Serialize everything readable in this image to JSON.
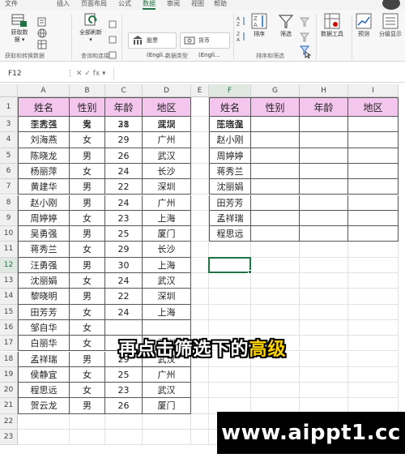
{
  "ribbon": {
    "tabs": [
      "文件",
      "插入",
      "页面布局",
      "公式",
      "数据",
      "审阅",
      "视图",
      "帮助"
    ],
    "active_tab": "数据",
    "get_data": {
      "label1": "获取数",
      "label2": "据 ▾"
    },
    "small_items": [
      "",
      "",
      ""
    ],
    "refresh_all": {
      "label1": "全部刷新",
      "label2": "▾"
    },
    "data_types": [
      {
        "label": "股票 (Engli..."
      },
      {
        "label": "货币 (Engli..."
      }
    ],
    "sort_label": "排序",
    "filter_label": "筛选",
    "data_tools_label": "数据工具",
    "forecast_label": "预测",
    "outline_label": "分级显示",
    "groups": {
      "get_transform": "获取和转换数据",
      "queries": "查询和连接",
      "data_types": "数据类型",
      "sort_filter": "排序和筛选"
    }
  },
  "formula_bar": {
    "name_box": "F12",
    "icons": "⋮  ✕  ✓  fx  ▾",
    "value": ""
  },
  "columns": [
    "A",
    "B",
    "C",
    "D",
    "E",
    "F",
    "G",
    "H",
    "I"
  ],
  "rows": [
    "1",
    "2",
    "3",
    "4",
    "5",
    "6",
    "7",
    "8",
    "9",
    "10",
    "11",
    "12",
    "13",
    "14",
    "15",
    "16",
    "17",
    "18",
    "19",
    "20",
    "21",
    "22",
    "23"
  ],
  "main_table": {
    "headers": [
      "姓名",
      "性别",
      "年龄",
      "地区"
    ],
    "rows": [
      [
        "李秀兰",
        "女",
        "31",
        "武汉"
      ],
      [
        "王志强",
        "男",
        "28",
        "深圳"
      ],
      [
        "刘海燕",
        "女",
        "29",
        "广州"
      ],
      [
        "陈晓龙",
        "男",
        "26",
        "武汉"
      ],
      [
        "杨丽萍",
        "女",
        "24",
        "长沙"
      ],
      [
        "黄建华",
        "男",
        "22",
        "深圳"
      ],
      [
        "赵小刚",
        "男",
        "24",
        "广州"
      ],
      [
        "周婷婷",
        "女",
        "23",
        "上海"
      ],
      [
        "吴勇强",
        "男",
        "25",
        "厦门"
      ],
      [
        "蒋秀兰",
        "女",
        "29",
        "长沙"
      ],
      [
        "汪勇强",
        "男",
        "30",
        "上海"
      ],
      [
        "沈丽娟",
        "女",
        "24",
        "武汉"
      ],
      [
        "黎晓明",
        "男",
        "22",
        "深圳"
      ],
      [
        "田芳芳",
        "女",
        "24",
        "上海"
      ],
      [
        "邹自华",
        "女",
        "",
        ""
      ],
      [
        "白丽华",
        "女",
        "",
        "深圳"
      ],
      [
        "孟祥瑞",
        "男",
        "29",
        "武汉"
      ],
      [
        "侯静宜",
        "女",
        "25",
        "广州"
      ],
      [
        "程思远",
        "女",
        "23",
        "武汉"
      ],
      [
        "贺云龙",
        "男",
        "26",
        "厦门"
      ]
    ]
  },
  "criteria_table": {
    "headers": [
      "姓名",
      "性别",
      "年龄",
      "地区"
    ],
    "names": [
      "王志强",
      "陈晓龙",
      "赵小刚",
      "周婷婷",
      "蒋秀兰",
      "沈丽娟",
      "田芳芳",
      "孟祥瑞",
      "程思远"
    ]
  },
  "subtitle": {
    "normal": "再点击筛选下的",
    "highlight": "高级"
  },
  "watermark": "www.aippt1.cc",
  "colors": {
    "header_fill": "#f4c6ee",
    "excel_green": "#217346",
    "highlight": "#ffd400"
  }
}
